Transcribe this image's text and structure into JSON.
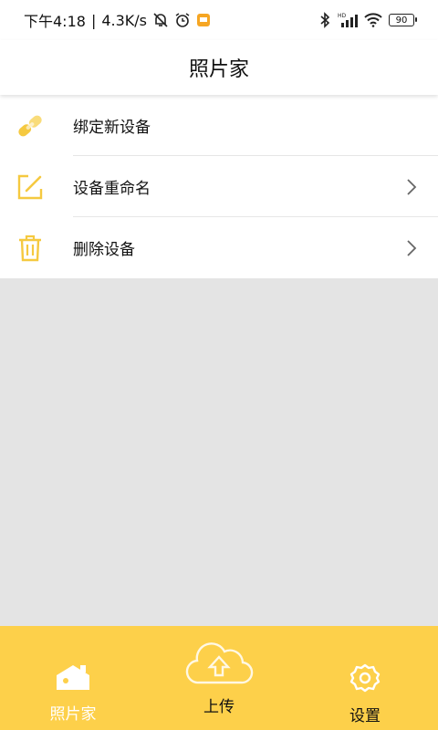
{
  "status_bar": {
    "time": "下午4:18",
    "separator": "|",
    "speed": "4.3K/s",
    "icons": [
      "mute-bell-icon",
      "alarm-icon",
      "notification-app-icon",
      "bluetooth-icon",
      "signal-hd-icon",
      "wifi-icon"
    ],
    "battery": "90"
  },
  "header": {
    "title": "照片家"
  },
  "menu": {
    "items": [
      {
        "label": "绑定新设备",
        "icon": "link-icon",
        "has_chevron": false
      },
      {
        "label": "设备重命名",
        "icon": "edit-icon",
        "has_chevron": true
      },
      {
        "label": "删除设备",
        "icon": "trash-icon",
        "has_chevron": true
      }
    ]
  },
  "bottom_nav": {
    "tabs": [
      {
        "label": "照片家",
        "icon": "house-icon",
        "active": true
      },
      {
        "label": "上传",
        "icon": "cloud-upload-icon",
        "active": false
      },
      {
        "label": "设置",
        "icon": "gear-icon",
        "active": false
      }
    ]
  },
  "colors": {
    "accent": "#fdd04a",
    "icon_yellow": "#f5c940",
    "content_bg": "#e4e4e4",
    "header_bg": "#ffffff"
  }
}
